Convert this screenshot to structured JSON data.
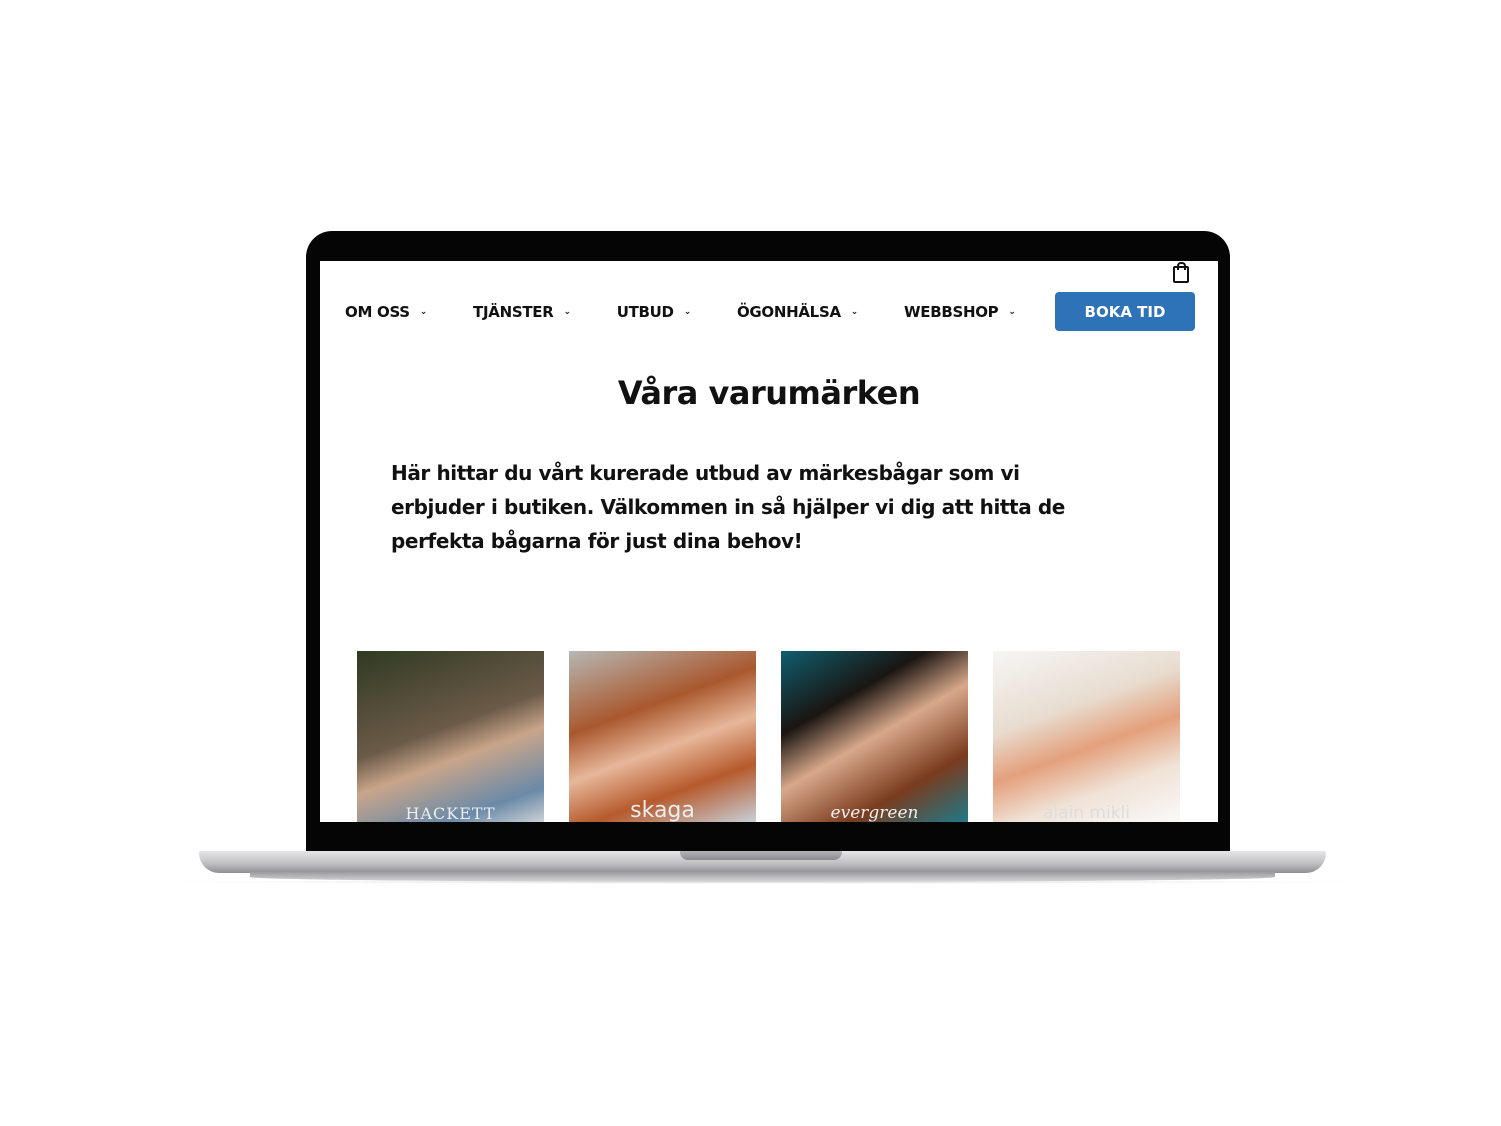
{
  "nav": {
    "items": [
      {
        "label": "OM OSS"
      },
      {
        "label": "TJÄNSTER"
      },
      {
        "label": "UTBUD"
      },
      {
        "label": "ÖGONHÄLSA"
      },
      {
        "label": "WEBBSHOP"
      }
    ],
    "chevron": "⌄",
    "cta": "BOKA TID",
    "cta_color": "#2e72b8"
  },
  "page": {
    "title": "Våra varumärken",
    "intro": "Här hittar du vårt kurerade utbud av märkesbågar som vi erbjuder i butiken. Välkommen in så hjälper vi dig att hitta de perfekta bågarna för just dina behov!"
  },
  "brands": [
    {
      "name": "HACKETT"
    },
    {
      "name": "skaga"
    },
    {
      "name": "evergreen"
    },
    {
      "name": "alain mikli"
    }
  ]
}
